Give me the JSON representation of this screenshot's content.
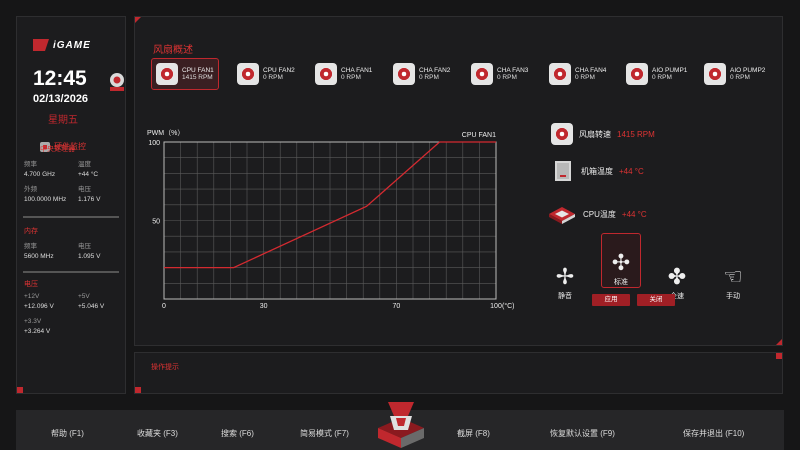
{
  "sidebar": {
    "logo": "iGAME",
    "time": "12:45",
    "date": "02/13/2026",
    "weekday": "星期五",
    "hw_title": "硬件监控",
    "cpu": {
      "title": "中央处理器",
      "freq_label": "频率",
      "freq": "4.700 GHz",
      "temp_label": "温度",
      "temp": "+44 °C",
      "ext_label": "外频",
      "ext": "100.0000 MHz",
      "volt_label": "电压",
      "volt": "1.176 V"
    },
    "mem": {
      "title": "内存",
      "freq_label": "频率",
      "freq": "5600 MHz",
      "volt_label": "电压",
      "volt": "1.095 V"
    },
    "voltage": {
      "title": "电压",
      "v12_label": "+12V",
      "v12": "+12.096 V",
      "v5_label": "+5V",
      "v5": "+5.046 V",
      "v33_label": "+3.3V",
      "v33": "+3.264 V"
    }
  },
  "main": {
    "title": "风扇概述",
    "fans": [
      {
        "name": "CPU FAN1",
        "rpm": "1415 RPM"
      },
      {
        "name": "CPU FAN2",
        "rpm": "0 RPM"
      },
      {
        "name": "CHA FAN1",
        "rpm": "0 RPM"
      },
      {
        "name": "CHA FAN2",
        "rpm": "0 RPM"
      },
      {
        "name": "CHA FAN3",
        "rpm": "0 RPM"
      },
      {
        "name": "CHA FAN4",
        "rpm": "0 RPM"
      },
      {
        "name": "AIO PUMP1",
        "rpm": "0 RPM"
      },
      {
        "name": "AIO PUMP2",
        "rpm": "0 RPM"
      }
    ],
    "fan_speed_label": "风扇转速",
    "fan_speed": "1415 RPM",
    "case_temp_label": "机箱温度",
    "case_temp": "+44 °C",
    "cpu_temp_label": "CPU温度",
    "cpu_temp": "+44 °C",
    "modes": [
      "静音",
      "标准",
      "全速",
      "手动"
    ],
    "apply": "应用",
    "close": "关闭"
  },
  "chart_data": {
    "type": "line",
    "title": "CPU FAN1",
    "ylabel": "PWM（%）",
    "xlabel": "(°C)",
    "xlim": [
      0,
      100
    ],
    "ylim": [
      0,
      100
    ],
    "x_ticks": [
      "0",
      "30",
      "70",
      "100"
    ],
    "y_ticks": [
      "50",
      "100"
    ],
    "grid": true,
    "series": [
      {
        "x": [
          0,
          21,
          61,
          83,
          100
        ],
        "y": [
          20,
          20,
          59,
          100,
          100
        ]
      }
    ]
  },
  "tips": {
    "title": "操作提示"
  },
  "bottom": {
    "help": "帮助 (F1)",
    "fav": "收藏夹 (F3)",
    "search": "搜索 (F6)",
    "easy": "简易模式 (F7)",
    "screenshot": "截屏 (F8)",
    "restore": "恢复默认设置 (F9)",
    "save_exit": "保存并退出 (F10)"
  },
  "colors": {
    "accent": "#c0282e",
    "bg": "#161617",
    "panel": "#1c1c1e"
  }
}
